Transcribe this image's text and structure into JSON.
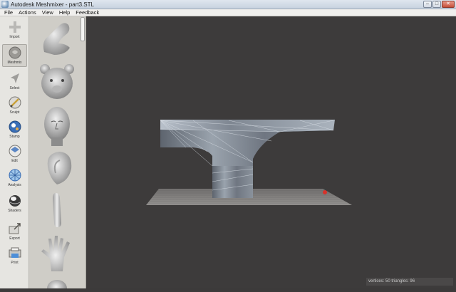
{
  "window": {
    "title": "Autodesk Meshmixer - part3.STL"
  },
  "menu": {
    "items": [
      "File",
      "Actions",
      "View",
      "Help",
      "Feedback"
    ]
  },
  "toolbar": {
    "tools": [
      {
        "label": "Import",
        "icon": "plus-icon"
      },
      {
        "label": "Meshmix",
        "icon": "meshmix-icon"
      },
      {
        "label": "Select",
        "icon": "arrow-icon"
      },
      {
        "label": "Sculpt",
        "icon": "brush-icon"
      },
      {
        "label": "Stamp",
        "icon": "stamp-icon"
      },
      {
        "label": "Edit",
        "icon": "edit-icon"
      },
      {
        "label": "Analysis",
        "icon": "analysis-icon"
      },
      {
        "label": "Shaders",
        "icon": "shader-sphere-icon"
      },
      {
        "label": "Export",
        "icon": "export-icon"
      },
      {
        "label": "Print",
        "icon": "printer-icon"
      }
    ]
  },
  "library": {
    "items": [
      "arm-part",
      "bear-head-part",
      "human-head-part",
      "ear-part",
      "finger-part",
      "hand-part",
      "sphere-part"
    ]
  },
  "status": {
    "text": "vertices: 50  triangles: 96"
  },
  "colors": {
    "viewport": "#3d3b3b",
    "mesh": "#a4acb6",
    "toolbar": "#e6e5e1",
    "library": "#cfcdc7"
  }
}
